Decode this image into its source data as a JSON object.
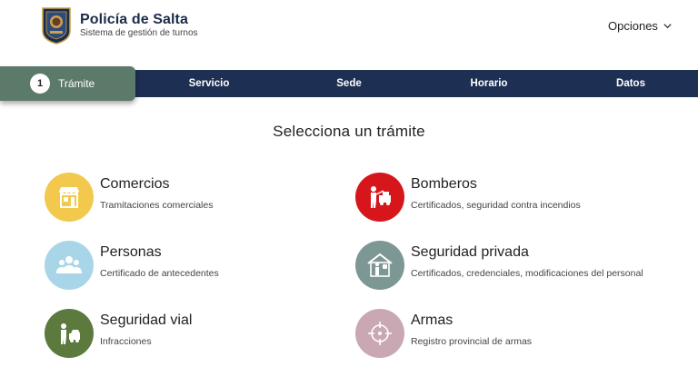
{
  "header": {
    "brand_title": "Policía de Salta",
    "brand_subtitle": "Sistema de gestión de turnos",
    "options_label": "Opciones"
  },
  "stepper": {
    "active_step_number": "1",
    "steps": [
      {
        "label": "Trámite"
      },
      {
        "label": "Servicio"
      },
      {
        "label": "Sede"
      },
      {
        "label": "Horario"
      },
      {
        "label": "Datos"
      }
    ]
  },
  "main": {
    "heading": "Selecciona un trámite",
    "cards": [
      {
        "title": "Comercios",
        "description": "Tramitaciones comerciales",
        "color": "#f2c94c",
        "icon": "storefront-icon"
      },
      {
        "title": "Bomberos",
        "description": "Certificados, seguridad contra incendios",
        "color": "#d6161b",
        "icon": "firefighter-icon"
      },
      {
        "title": "Personas",
        "description": "Certificado de antecedentes",
        "color": "#a8d6e8",
        "icon": "people-icon"
      },
      {
        "title": "Seguridad privada",
        "description": "Certificados, credenciales, modificaciones del personal",
        "color": "#7d9795",
        "icon": "guard-house-icon"
      },
      {
        "title": "Seguridad vial",
        "description": "Infracciones",
        "color": "#5c7a3e",
        "icon": "traffic-officer-icon"
      },
      {
        "title": "Armas",
        "description": "Registro provincial de armas",
        "color": "#c9a8b4",
        "icon": "crosshair-icon"
      }
    ]
  },
  "colors": {
    "navy": "#1d2f52",
    "active_step": "#5c7a6a"
  }
}
